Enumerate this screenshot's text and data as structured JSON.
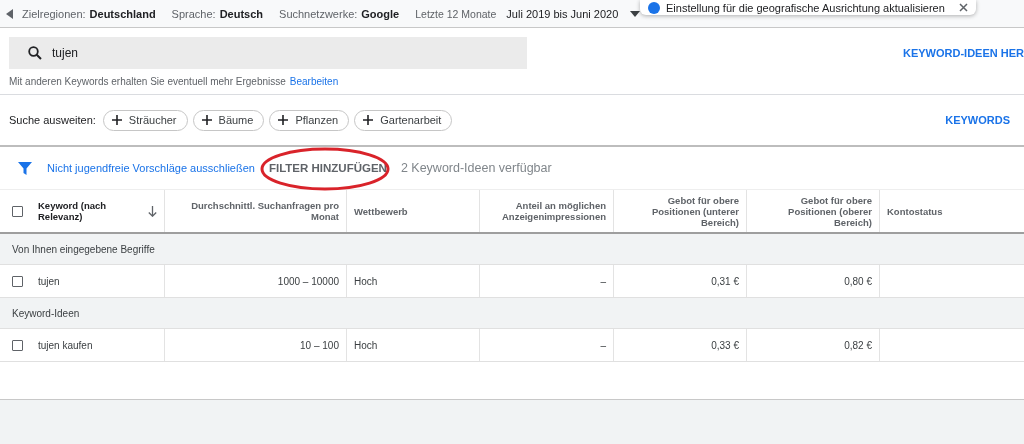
{
  "top_bar": {
    "items": [
      {
        "label": "Zielregionen:",
        "value": "Deutschland"
      },
      {
        "label": "Sprache:",
        "value": "Deutsch"
      },
      {
        "label": "Suchnetzwerke:",
        "value": "Google"
      }
    ],
    "period_label": "Letzte 12 Monate",
    "period_value": "Juli 2019 bis Juni 2020"
  },
  "toast": {
    "text": "Einstellung für die geografische Ausrichtung aktualisieren"
  },
  "search": {
    "value": "tujen",
    "action": "KEYWORD-IDEEN HER",
    "hint": "Mit anderen Keywords erhalten Sie eventuell mehr Ergebnisse",
    "hint_link": "Bearbeiten"
  },
  "broaden": {
    "label": "Suche ausweiten:",
    "chips": [
      "Sträucher",
      "Bäume",
      "Pflanzen",
      "Gartenarbeit"
    ],
    "action": "KEYWORDS"
  },
  "filter_bar": {
    "exclude_link": "Nicht jugendfreie Vorschläge ausschließen",
    "add_filter": "FILTER HINZUFÜGEN",
    "count": "2 Keyword-Ideen verfügbar",
    "annotation": true
  },
  "table": {
    "header_checked": false,
    "columns": [
      {
        "label": "Keyword (nach Relevanz)",
        "sorted": true
      },
      {
        "label": "Durchschnittl. Suchanfragen pro Monat",
        "sorted": false
      },
      {
        "label": "Wettbewerb",
        "sorted": false
      },
      {
        "label": "Anteil an möglichen Anzeigenimpressionen",
        "sorted": false
      },
      {
        "label": "Gebot für obere Positionen (unterer Bereich)",
        "sorted": false
      },
      {
        "label": "Gebot für obere Positionen (oberer Bereich)",
        "sorted": false
      },
      {
        "label": "Kontostatus",
        "sorted": false
      }
    ],
    "groups": [
      {
        "title": "Von Ihnen eingegebene Begriffe",
        "rows": [
          {
            "checked": false,
            "cells": [
              "tujen",
              "1000 – 10000",
              "Hoch",
              "–",
              "0,31 €",
              "0,80 €"
            ]
          }
        ]
      },
      {
        "title": "Keyword-Ideen",
        "rows": [
          {
            "checked": false,
            "cells": [
              "tujen kaufen",
              "10 – 100",
              "Hoch",
              "–",
              "0,33 €",
              "0,82 €"
            ]
          }
        ]
      }
    ]
  }
}
